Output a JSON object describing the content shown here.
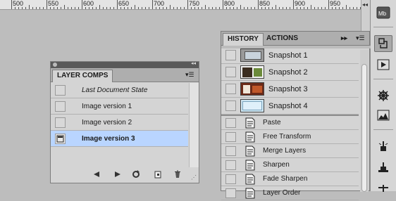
{
  "ruler": {
    "labels": [
      "500",
      "550",
      "600",
      "650",
      "700",
      "750",
      "800",
      "850",
      "900",
      "950"
    ]
  },
  "history_panel": {
    "tabs": [
      {
        "label": "HISTORY",
        "active": true
      },
      {
        "label": "ACTIONS",
        "active": false
      }
    ],
    "snapshots": [
      {
        "label": "Snapshot 1"
      },
      {
        "label": "Snapshot 2"
      },
      {
        "label": "Snapshot 3"
      },
      {
        "label": "Snapshot 4"
      }
    ],
    "states": [
      {
        "label": "Paste"
      },
      {
        "label": "Free Transform"
      },
      {
        "label": "Merge Layers"
      },
      {
        "label": "Sharpen"
      },
      {
        "label": "Fade Sharpen"
      },
      {
        "label": "Layer Order"
      }
    ]
  },
  "layer_comps_panel": {
    "title": "LAYER COMPS",
    "comps": [
      {
        "label": "Last Document State",
        "italic": true,
        "selected": false
      },
      {
        "label": "Image version 1",
        "italic": false,
        "selected": false
      },
      {
        "label": "Image version 2",
        "italic": false,
        "selected": false
      },
      {
        "label": "Image version 3",
        "italic": false,
        "selected": true
      }
    ],
    "footer_icons": [
      "previous-comp-icon",
      "next-comp-icon",
      "update-comp-icon",
      "new-comp-icon",
      "delete-comp-icon"
    ]
  },
  "dock": {
    "icons": [
      "mini-bridge-icon",
      "history-icon",
      "actions-play-icon",
      "navigator-wheel-icon",
      "histogram-icon",
      "brush-presets-icon",
      "clone-source-icon",
      "tool-presets-icon"
    ]
  },
  "colors": {
    "selection": "#b9d5ff",
    "panel_bg": "#d4d4d4",
    "canvas_bg": "#bdbdbd"
  }
}
